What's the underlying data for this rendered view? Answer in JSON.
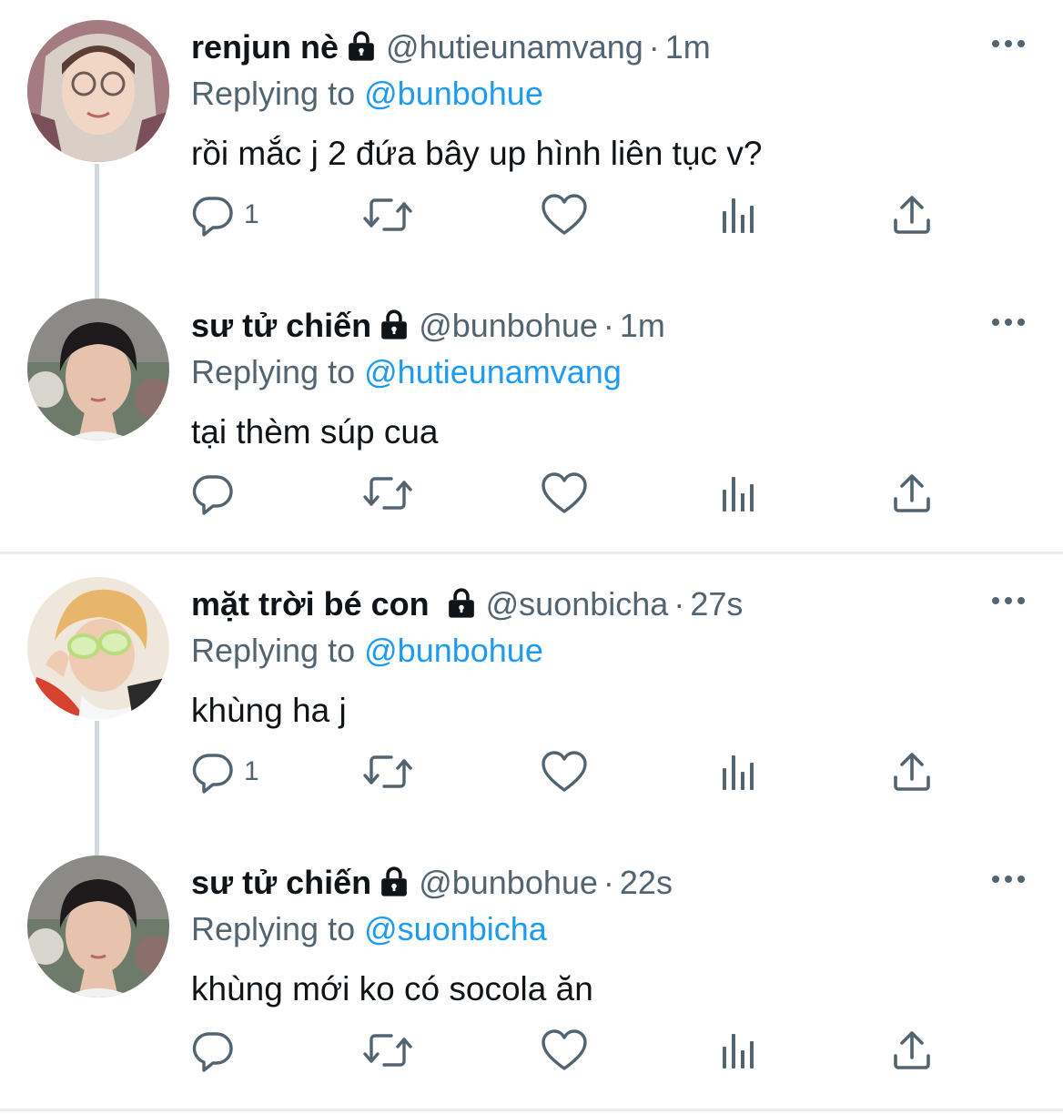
{
  "icons": {
    "lock": "lock-icon",
    "more": "more-dots-icon",
    "reply": "reply-icon",
    "retweet": "retweet-icon",
    "like": "heart-icon",
    "views": "analytics-icon",
    "share": "share-icon"
  },
  "colors": {
    "mention": "#1d9bf0",
    "muted": "#536471",
    "text": "#0f1419"
  },
  "replying_prefix": "Replying to",
  "tweets": [
    {
      "name": "renjun nè",
      "handle": "@hutieunamvang",
      "dot": "·",
      "time": "1m",
      "reply_to": "@bunbohue",
      "text": "rồi mắc j 2 đứa bây up hình liên tục v?",
      "reply_count": "1"
    },
    {
      "name": "sư tử chiến",
      "handle": "@bunbohue",
      "dot": "·",
      "time": "1m",
      "reply_to": "@hutieunamvang",
      "text": "tại thèm súp cua",
      "reply_count": ""
    },
    {
      "name": "mặt trời bé con",
      "handle": "@suonbicha",
      "dot": "·",
      "time": "27s",
      "reply_to": "@bunbohue",
      "text": "khùng ha j",
      "reply_count": "1"
    },
    {
      "name": "sư tử chiến",
      "handle": "@bunbohue",
      "dot": "·",
      "time": "22s",
      "reply_to": "@suonbicha",
      "text": "khùng mới ko có socola ăn",
      "reply_count": ""
    }
  ]
}
